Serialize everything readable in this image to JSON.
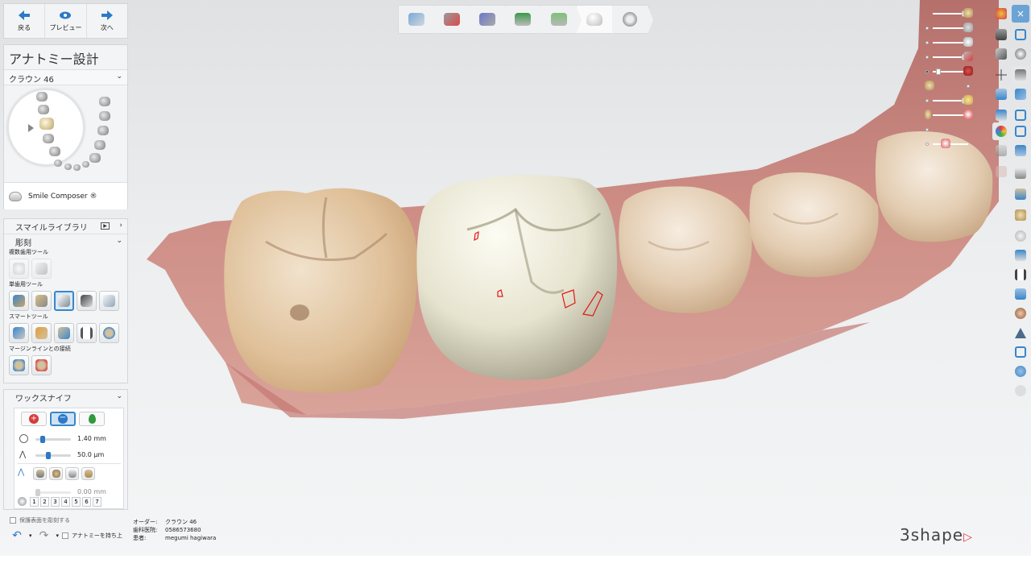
{
  "nav": {
    "back_label": "戻る",
    "preview_label": "プレビュー",
    "next_label": "次へ"
  },
  "design": {
    "title": "アナトミー設計",
    "selected_crown": "クラウン 46",
    "smile_composer_label": "Smile Composer ®"
  },
  "tools": {
    "smile_library_label": "スマイルライブラリ",
    "sculpt_label": "彫刻",
    "multi_tooth_tools_label": "複数歯用ツール",
    "single_tooth_tools_label": "単歯用ツール",
    "smart_tools_label": "スマートツール",
    "margin_connection_label": "マージンラインとの接続"
  },
  "wax_knife": {
    "label": "ワックスナイフ",
    "radius_value": "1.40 mm",
    "radius_fraction": 0.15,
    "height_value": "50.0 μm",
    "height_fraction": 0.35,
    "offset_value": "0.00 mm",
    "offset_fraction": 0.0,
    "numbers": [
      "1",
      "2",
      "3",
      "4",
      "5",
      "6",
      "7"
    ]
  },
  "bottom": {
    "protect_label": "保護表面を彫刻する",
    "keep_anatomy_label": "アナトミーを持ち上"
  },
  "order": {
    "order_label": "オーダー:",
    "order_value": "クラウン 46",
    "clinic_label": "歯科医院:",
    "clinic_value": "0586573680",
    "patient_label": "患者:",
    "patient_value": "megumi hagiwara"
  },
  "brand": {
    "name": "3shape"
  },
  "colors": {
    "accent": "#2c79c7",
    "gum": "#c9837c",
    "crown": "#e8e6d6",
    "tooth": "#e7d8c2",
    "contact_marks": "#e01818",
    "brand_red": "#e0343f"
  },
  "icons": {
    "workflow": [
      "scan-prep-icon",
      "trim-icon",
      "margin-line-icon",
      "insertion-direction-icon",
      "cement-gap-icon",
      "anatomy-design-icon",
      "finalize-icon"
    ],
    "right_toolbar": [
      "color-icon",
      "close-icon",
      "camera-icon",
      "fullscreen-icon",
      "view-icon",
      "sphere-icon",
      "axis-icon",
      "jaw-icon",
      "cross-section-icon",
      "frame-icon",
      "clipping-icon",
      "box-icon",
      "texture-icon",
      "color-map-icon",
      "monitor-icon",
      "cube-icon",
      "layer-icon",
      "caution-icon"
    ]
  }
}
